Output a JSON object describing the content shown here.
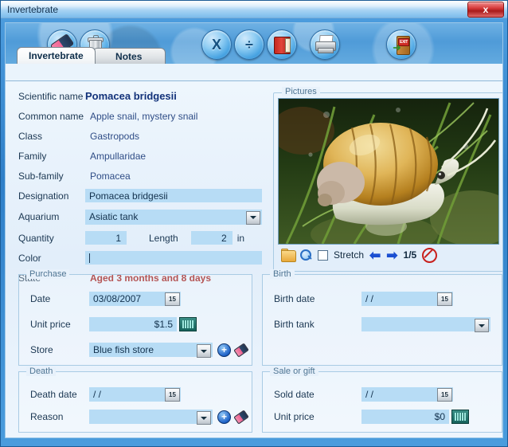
{
  "window": {
    "title": "Invertebrate",
    "close_label": "x"
  },
  "toolbar": {
    "buttons": [
      {
        "name": "clear-button",
        "icon": "eraser-icon",
        "label": ""
      },
      {
        "name": "delete-button",
        "icon": "trash-icon",
        "label": ""
      },
      {
        "name": "export-excel-button",
        "icon": "letter-x-icon",
        "label": "X"
      },
      {
        "name": "divide-button",
        "icon": "divide-icon",
        "label": "÷"
      },
      {
        "name": "book-button",
        "icon": "red-book-icon",
        "label": ""
      },
      {
        "name": "print-button",
        "icon": "printer-icon",
        "label": ""
      },
      {
        "name": "exit-button",
        "icon": "exit-door-icon",
        "label": "EXIT"
      }
    ]
  },
  "tabs": [
    {
      "label": "Invertebrate",
      "active": true
    },
    {
      "label": "Notes",
      "active": false
    }
  ],
  "form": {
    "scientific_name": {
      "label": "Scientific name",
      "value": "Pomacea bridgesii"
    },
    "common_name": {
      "label": "Common name",
      "value": "Apple snail, mystery snail"
    },
    "class": {
      "label": "Class",
      "value": "Gastropods"
    },
    "family": {
      "label": "Family",
      "value": "Ampullaridae"
    },
    "sub_family": {
      "label": "Sub-family",
      "value": "Pomacea"
    },
    "designation": {
      "label": "Designation",
      "value": "Pomacea bridgesii"
    },
    "aquarium": {
      "label": "Aquarium",
      "value": "Asiatic tank"
    },
    "quantity": {
      "label": "Quantity",
      "value": "1"
    },
    "length": {
      "label": "Length",
      "value": "2",
      "unit": "in"
    },
    "color": {
      "label": "Color",
      "value": ""
    },
    "state": {
      "label": "State",
      "value": "Aged 3 months and 8 days"
    }
  },
  "pictures": {
    "title": "Pictures",
    "stretch_label": "Stretch",
    "counter": "1/5",
    "calendar_glyph": "15"
  },
  "purchase": {
    "title": "Purchase",
    "date": {
      "label": "Date",
      "value": "03/08/2007"
    },
    "unit_price": {
      "label": "Unit price",
      "value": "$1.5"
    },
    "store": {
      "label": "Store",
      "value": "Blue fish store"
    }
  },
  "birth": {
    "title": "Birth",
    "birth_date": {
      "label": "Birth date",
      "value": "  /  /"
    },
    "birth_tank": {
      "label": "Birth tank",
      "value": ""
    }
  },
  "death": {
    "title": "Death",
    "death_date": {
      "label": "Death date",
      "value": "  /  /"
    },
    "reason": {
      "label": "Reason",
      "value": ""
    }
  },
  "sale": {
    "title": "Sale or gift",
    "sold_date": {
      "label": "Sold date",
      "value": "  /  /"
    },
    "unit_price": {
      "label": "Unit price",
      "value": "$0"
    }
  },
  "colors": {
    "field_bg": "#b7dcf5",
    "accent_blue": "#2f7fc8",
    "state_red": "#9b1b1b",
    "sci_name": "#12327a",
    "group_title": "#4f7593"
  }
}
